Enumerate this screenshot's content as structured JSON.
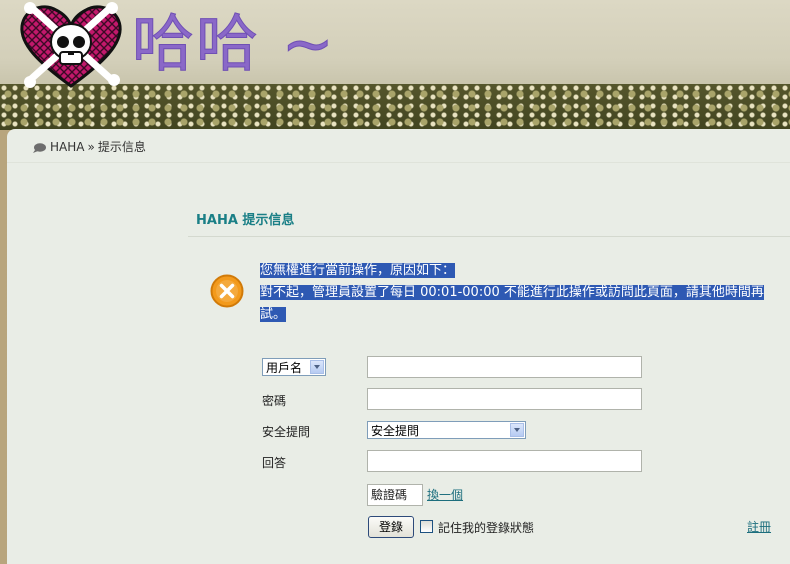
{
  "header": {
    "site_title": "哈哈 ~"
  },
  "breadcrumb": {
    "home": "HAHA",
    "separator": "»",
    "current": "提示信息"
  },
  "box": {
    "title": "HAHA 提示信息"
  },
  "message": {
    "line1": "您無權進行當前操作，原因如下：",
    "line2": "對不起，管理員設置了每日 00:01-00:00 不能進行此操作或訪問此頁面，請其他時間再試。"
  },
  "form": {
    "login_field_select": "用戶名",
    "password_label": "密碼",
    "security_question_label": "安全提問",
    "security_question_select": "安全提問",
    "answer_label": "回答",
    "captcha_placeholder": "驗證碼",
    "change_captcha": "換一個",
    "login_button": "登錄",
    "remember_me": "記住我的登錄狀態",
    "register_link": "註冊"
  },
  "icons": {
    "breadcrumb_icon": "speech-bubble-icon",
    "error_icon": "error-x-icon",
    "logo": "skull-heart-logo"
  },
  "colors": {
    "title_purple": "#8a68c8",
    "link_teal": "#1a7f86",
    "selection_blue": "#2e59b3",
    "error_orange": "#f39a1c"
  }
}
